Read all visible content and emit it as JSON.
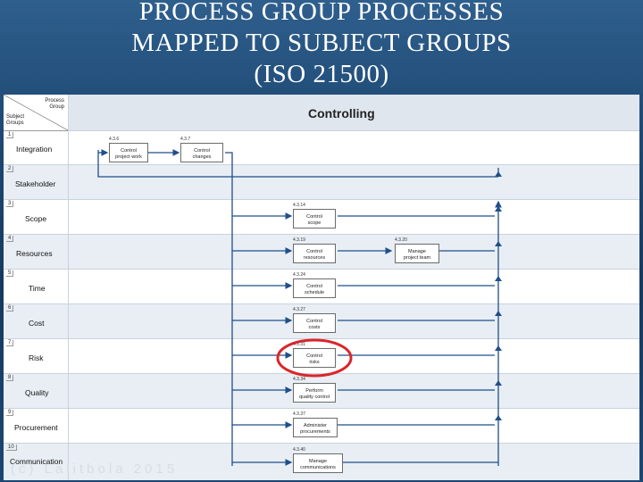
{
  "title": {
    "line1": "PROCESS GROUP PROCESSES",
    "line2": "MAPPED TO SUBJECT GROUPS",
    "line3": "(ISO 21500)"
  },
  "header": {
    "process_group_line1": "Process",
    "process_group_line2": "Group",
    "subject_groups_line1": "Subject",
    "subject_groups_line2": "Groups",
    "column_title": "Controlling"
  },
  "rows": [
    {
      "num": "1",
      "label": "Integration"
    },
    {
      "num": "2",
      "label": "Stakeholder"
    },
    {
      "num": "3",
      "label": "Scope"
    },
    {
      "num": "4",
      "label": "Resources"
    },
    {
      "num": "5",
      "label": "Time"
    },
    {
      "num": "6",
      "label": "Cost"
    },
    {
      "num": "7",
      "label": "Risk"
    },
    {
      "num": "8",
      "label": "Quality"
    },
    {
      "num": "9",
      "label": "Procurement"
    },
    {
      "num": "10",
      "label": "Communication"
    }
  ],
  "boxes": [
    {
      "code": "4.3.6",
      "line1": "Control",
      "line2": "project work"
    },
    {
      "code": "4.3.7",
      "line1": "Control",
      "line2": "changes"
    },
    {
      "code": "4.3.14",
      "line1": "Control",
      "line2": "scope"
    },
    {
      "code": "4.3.19",
      "line1": "Control",
      "line2": "resources"
    },
    {
      "code": "4.3.20",
      "line1": "Manage",
      "line2": "project team"
    },
    {
      "code": "4.3.24",
      "line1": "Control",
      "line2": "schedule"
    },
    {
      "code": "4.3.27",
      "line1": "Control",
      "line2": "costs"
    },
    {
      "code": "4.3.31",
      "line1": "Control",
      "line2": "risks"
    },
    {
      "code": "4.3.34",
      "line1": "Perform",
      "line2": "quality control"
    },
    {
      "code": "4.3.37",
      "line1": "Administer",
      "line2": "procurements"
    },
    {
      "code": "4.3.40",
      "line1": "Manage",
      "line2": "communications"
    }
  ],
  "watermark": "(c) Lalitbola 2015",
  "colors": {
    "background": "#1f4a75",
    "highlight_circle": "#d9262b",
    "connector": "#1f4f8a"
  }
}
